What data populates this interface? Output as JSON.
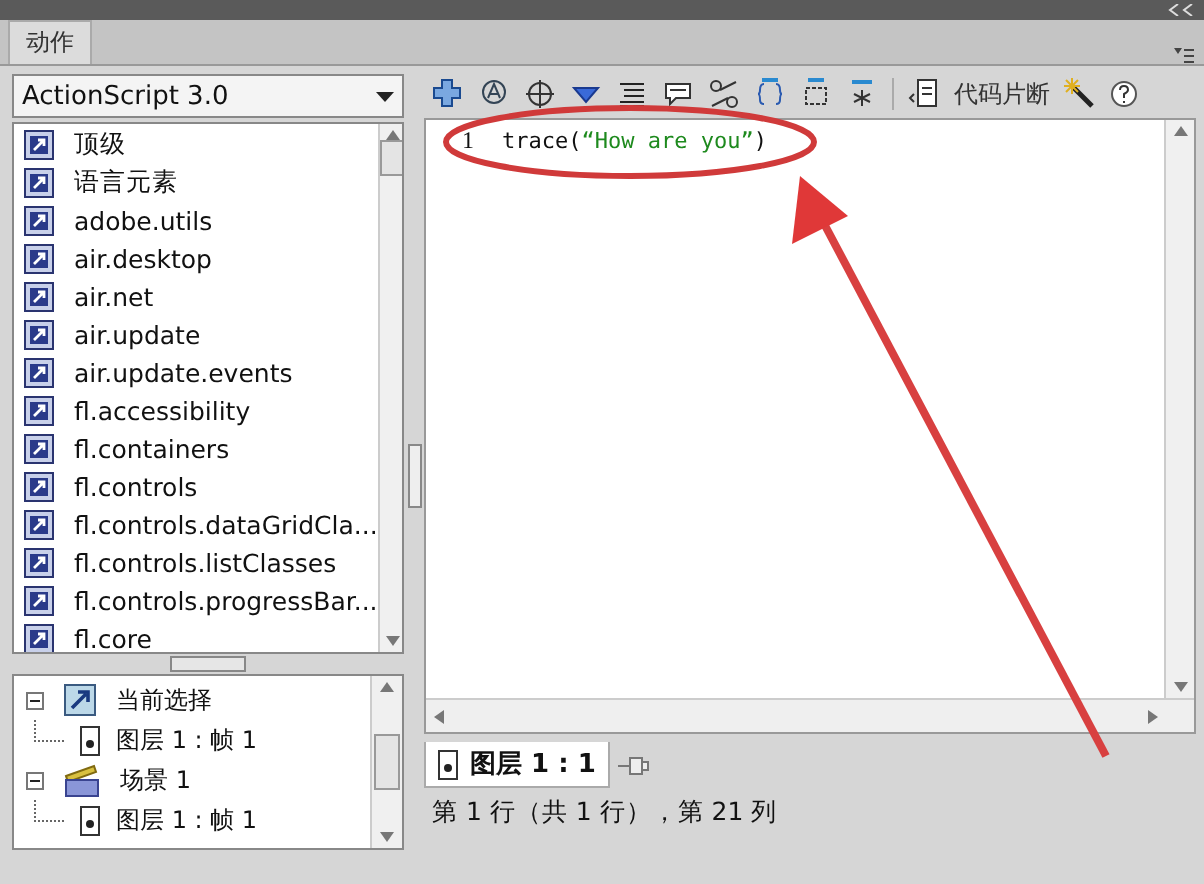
{
  "panel": {
    "tab": "动作"
  },
  "library": {
    "version": "ActionScript 3.0",
    "items": [
      {
        "label": "顶级"
      },
      {
        "label": "语言元素"
      },
      {
        "label": "adobe.utils"
      },
      {
        "label": "air.desktop"
      },
      {
        "label": "air.net"
      },
      {
        "label": "air.update"
      },
      {
        "label": "air.update.events"
      },
      {
        "label": "fl.accessibility"
      },
      {
        "label": "fl.containers"
      },
      {
        "label": "fl.controls"
      },
      {
        "label": "fl.controls.dataGridCla..."
      },
      {
        "label": "fl.controls.listClasses"
      },
      {
        "label": "fl.controls.progressBar..."
      },
      {
        "label": "fl.core"
      }
    ]
  },
  "tree": [
    {
      "label": "当前选择",
      "kind": "selection",
      "expanded": true,
      "children": [
        {
          "label": "图层 1 : 帧 1"
        }
      ]
    },
    {
      "label": "场景 1",
      "kind": "scene",
      "expanded": true,
      "children": [
        {
          "label": "图层 1 : 帧 1"
        }
      ]
    }
  ],
  "toolbar": {
    "snippets_label": "代码片断"
  },
  "editor": {
    "lines": [
      {
        "number": "1",
        "parts": [
          {
            "text": "trace(",
            "kind": "plain"
          },
          {
            "text": "“How are you”",
            "kind": "string"
          },
          {
            "text": ")",
            "kind": "plain"
          }
        ]
      }
    ]
  },
  "script_tab": {
    "label": "图层 1 : 1"
  },
  "status": "第 1 行（共 1 行），第 21 列"
}
